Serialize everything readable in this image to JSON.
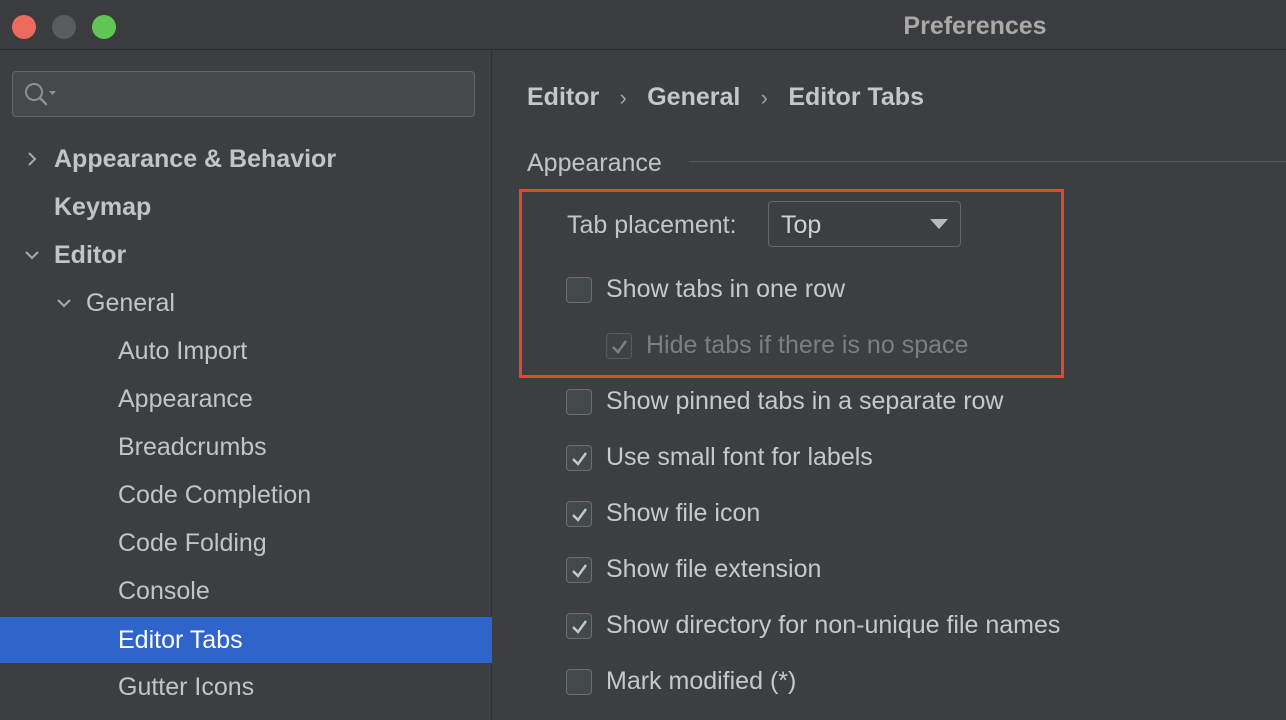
{
  "window": {
    "title": "Preferences"
  },
  "sidebar": {
    "search": {
      "placeholder": ""
    },
    "items": [
      {
        "label": "Appearance & Behavior",
        "chevron": "right"
      },
      {
        "label": "Keymap"
      },
      {
        "label": "Editor",
        "chevron": "down"
      },
      {
        "label": "General",
        "chevron": "down"
      },
      {
        "label": "Auto Import"
      },
      {
        "label": "Appearance"
      },
      {
        "label": "Breadcrumbs"
      },
      {
        "label": "Code Completion"
      },
      {
        "label": "Code Folding"
      },
      {
        "label": "Console"
      },
      {
        "label": "Editor Tabs",
        "selected": true
      },
      {
        "label": "Gutter Icons"
      }
    ]
  },
  "breadcrumb": {
    "items": [
      "Editor",
      "General",
      "Editor Tabs"
    ],
    "separator": "›"
  },
  "section": {
    "title": "Appearance"
  },
  "tab_placement": {
    "label": "Tab placement:",
    "value": "Top"
  },
  "options": [
    {
      "label": "Show tabs in one row",
      "checked": false
    },
    {
      "label": "Hide tabs if there is no space",
      "checked": true,
      "disabled": true
    },
    {
      "label": "Show pinned tabs in a separate row",
      "checked": false
    },
    {
      "label": "Use small font for labels",
      "checked": true
    },
    {
      "label": "Show file icon",
      "checked": true
    },
    {
      "label": "Show file extension",
      "checked": true
    },
    {
      "label": "Show directory for non-unique file names",
      "checked": true
    },
    {
      "label": "Mark modified (*)",
      "checked": false
    }
  ],
  "colors": {
    "selection": "#2f65ca",
    "highlight_box": "#e04a2c",
    "background": "#3c3f41"
  },
  "icons": {
    "search": "search-icon",
    "chevron_right": "chevron-right-icon",
    "chevron_down": "chevron-down-icon",
    "dropdown": "triangle-down-icon",
    "check": "checkmark-icon"
  }
}
